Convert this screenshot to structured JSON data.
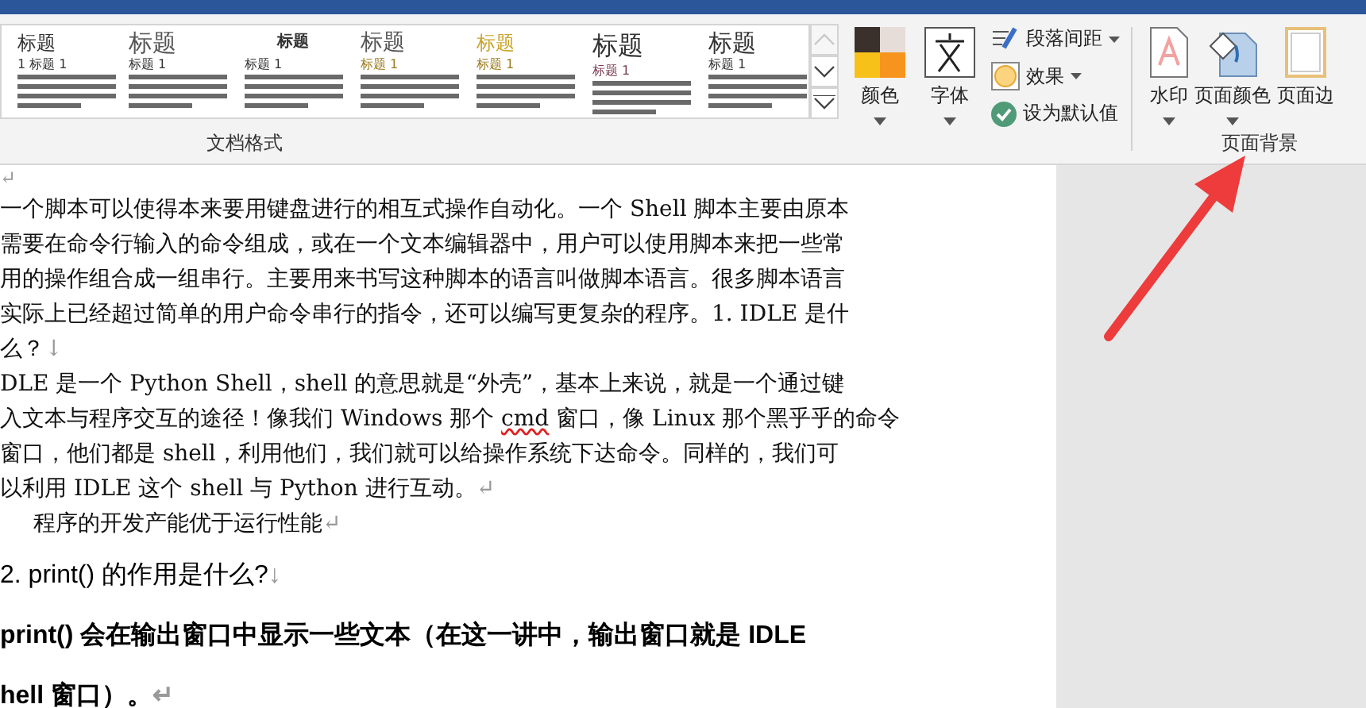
{
  "ribbon": {
    "style_gallery": [
      {
        "title": "标题",
        "subtitle": "1  标题 1",
        "kind": "basic"
      },
      {
        "title": "标题",
        "subtitle": "标题 1",
        "kind": "light"
      },
      {
        "title": "标题",
        "subtitle": "标题 1",
        "kind": "bold"
      },
      {
        "title": "标题",
        "subtitle": "标题 1",
        "kind": "gold"
      },
      {
        "title": "标题",
        "subtitle": "标题 1",
        "kind": "amber"
      },
      {
        "title": "标题",
        "subtitle": "标题 1",
        "kind": "large"
      },
      {
        "title": "标题",
        "subtitle": "标题 1",
        "kind": "classic"
      }
    ],
    "gallery_scroll": [
      {
        "kind": "up",
        "disabled": true
      },
      {
        "kind": "down",
        "disabled": false
      },
      {
        "kind": "more",
        "disabled": false
      }
    ],
    "theme_buttons": [
      {
        "label": "颜色",
        "kind": "colors"
      },
      {
        "label": "字体",
        "kind": "fonts"
      }
    ],
    "paragraph_options": [
      {
        "label": "段落间距",
        "kind": "spacing",
        "dropdown": true
      },
      {
        "label": "效果",
        "kind": "effects",
        "dropdown": true
      },
      {
        "label": "设为默认值",
        "kind": "default",
        "dropdown": false
      }
    ],
    "group_label_formatting": "文档格式",
    "page_background_buttons": [
      {
        "label": "水印",
        "kind": "watermark"
      },
      {
        "label": "页面颜色",
        "kind": "page-color"
      },
      {
        "label": "页面边",
        "kind": "page-border"
      }
    ],
    "group_label_background": "页面背景"
  },
  "document": {
    "lines": [
      {
        "kind": "mark",
        "mark": "↵"
      },
      {
        "kind": "body",
        "parts": [
          {
            "text": "一个脚本可以使得本来要用键盘进行的相互式操作自动化。一个 Shell 脚本主要由原本",
            "misspelled": false
          }
        ]
      },
      {
        "kind": "body",
        "parts": [
          {
            "text": "需要在命令行输入的命令组成，或在一个文本编辑器中，用户可以使用脚本来把一些常",
            "misspelled": false
          }
        ]
      },
      {
        "kind": "body",
        "parts": [
          {
            "text": "用的操作组合成一组串行。主要用来书写这种脚本的语言叫做脚本语言。很多脚本语言",
            "misspelled": false
          }
        ]
      },
      {
        "kind": "body",
        "parts": [
          {
            "text": "实际上已经超过简单的用户命令串行的指令，还可以编写更复杂的程序。1. IDLE 是什",
            "misspelled": false
          }
        ]
      },
      {
        "kind": "body",
        "parts": [
          {
            "text": "么？",
            "misspelled": false
          }
        ],
        "mark": "↓"
      },
      {
        "kind": "body",
        "parts": [
          {
            "text": "DLE 是一个 Python Shell，shell 的意思就是“外壳”，基本上来说，就是一个通过键",
            "misspelled": false
          }
        ]
      },
      {
        "kind": "body",
        "parts": [
          {
            "text": "入文本与程序交互的途径！像我们 Windows 那个 ",
            "misspelled": false
          },
          {
            "text": "cmd",
            "misspelled": true
          },
          {
            "text": " 窗口，像 Linux 那个黑乎乎的命令",
            "misspelled": false
          }
        ]
      },
      {
        "kind": "body",
        "parts": [
          {
            "text": "窗口，他们都是 shell，利用他们，我们就可以给操作系统下达命令。同样的，我们可",
            "misspelled": false
          }
        ]
      },
      {
        "kind": "body",
        "parts": [
          {
            "text": "以利用 IDLE 这个 shell 与 Python 进行互动。",
            "misspelled": false
          }
        ],
        "mark": "↵"
      },
      {
        "kind": "indent",
        "parts": [
          {
            "text": "程序的开发产能优于运行性能",
            "misspelled": false
          }
        ],
        "mark": "↵"
      },
      {
        "kind": "heading",
        "parts": [
          {
            "text": "2. print()  的作用是什么? ",
            "misspelled": false
          }
        ],
        "mark": "↓"
      },
      {
        "kind": "bold",
        "parts": [
          {
            "text": "print()  会在输出窗口中显示一些文本（在这一讲中，输出窗口就是 IDLE",
            "misspelled": false
          }
        ]
      },
      {
        "kind": "bold",
        "parts": [
          {
            "text": "hell 窗口）。",
            "misspelled": false
          }
        ],
        "mark": "↵"
      }
    ]
  }
}
